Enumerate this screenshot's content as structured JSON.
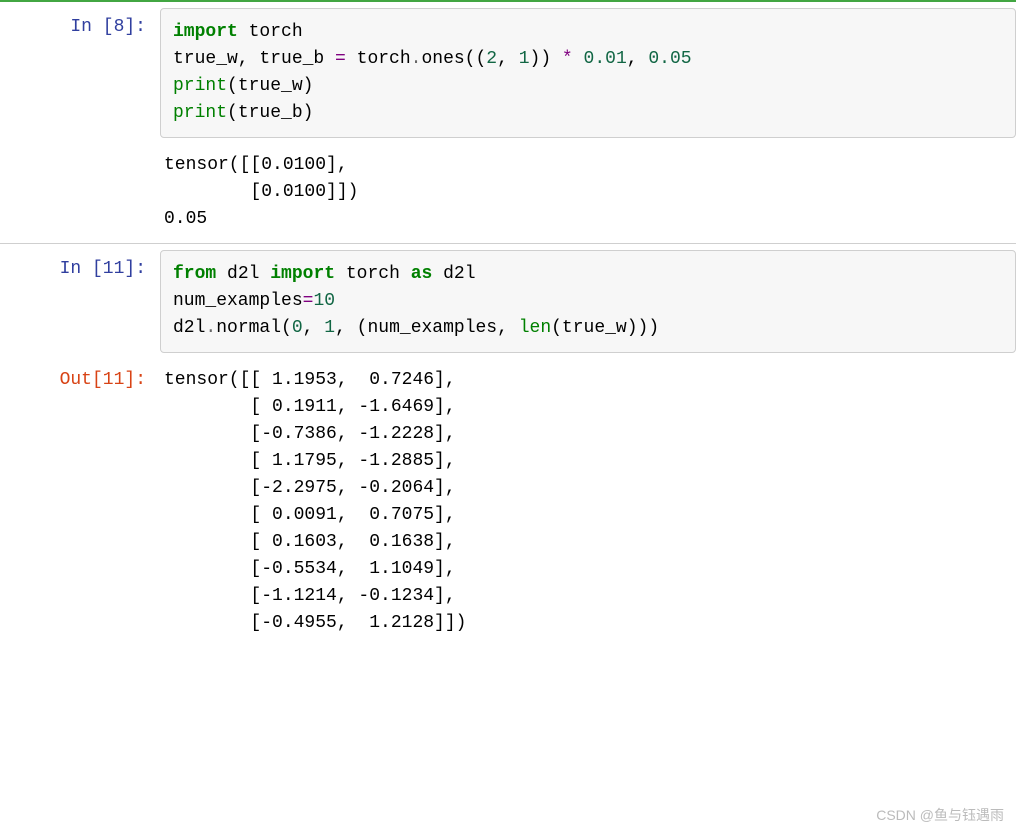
{
  "cells": [
    {
      "in_prompt": "In [8]:",
      "code_tokens": [
        [
          [
            "k-green",
            "import"
          ],
          [
            "",
            null,
            " "
          ],
          [
            "ident",
            "torch"
          ]
        ],
        [
          [
            "ident",
            "true_w, true_b "
          ],
          [
            "k-purple",
            "="
          ],
          [
            "ident",
            " torch"
          ],
          [
            "op",
            "."
          ],
          [
            "ident",
            "ones(("
          ],
          [
            "num",
            "2"
          ],
          [
            "ident",
            ", "
          ],
          [
            "num",
            "1"
          ],
          [
            "ident",
            ")) "
          ],
          [
            "k-purple",
            "*"
          ],
          [
            "ident",
            " "
          ],
          [
            "num",
            "0.01"
          ],
          [
            "ident",
            ", "
          ],
          [
            "num",
            "0.05"
          ]
        ],
        [
          [
            "builtin",
            "print"
          ],
          [
            "ident",
            "(true_w)"
          ]
        ],
        [
          [
            "builtin",
            "print"
          ],
          [
            "ident",
            "(true_b)"
          ]
        ]
      ],
      "stream": "tensor([[0.0100],\n        [0.0100]])\n0.05"
    },
    {
      "in_prompt": "In [11]:",
      "out_prompt": "Out[11]:",
      "code_tokens": [
        [
          [
            "k-green",
            "from"
          ],
          [
            "",
            null,
            " "
          ],
          [
            "ident",
            "d2l "
          ],
          [
            "k-green",
            "import"
          ],
          [
            "",
            null,
            " "
          ],
          [
            "ident",
            "torch "
          ],
          [
            "k-green",
            "as"
          ],
          [
            "",
            null,
            " "
          ],
          [
            "ident",
            "d2l"
          ]
        ],
        [
          [
            "ident",
            "num_examples"
          ],
          [
            "k-purple",
            "="
          ],
          [
            "num",
            "10"
          ]
        ],
        [
          [
            "ident",
            "d2l"
          ],
          [
            "op",
            "."
          ],
          [
            "ident",
            "normal("
          ],
          [
            "num",
            "0"
          ],
          [
            "ident",
            ", "
          ],
          [
            "num",
            "1"
          ],
          [
            "ident",
            ", (num_examples, "
          ],
          [
            "builtin",
            "len"
          ],
          [
            "ident",
            "(true_w)))"
          ]
        ]
      ],
      "execout": "tensor([[ 1.1953,  0.7246],\n        [ 0.1911, -1.6469],\n        [-0.7386, -1.2228],\n        [ 1.1795, -1.2885],\n        [-2.2975, -0.2064],\n        [ 0.0091,  0.7075],\n        [ 0.1603,  0.1638],\n        [-0.5534,  1.1049],\n        [-1.1214, -0.1234],\n        [-0.4955,  1.2128]])"
    }
  ],
  "watermark": "CSDN @鱼与钰遇雨"
}
